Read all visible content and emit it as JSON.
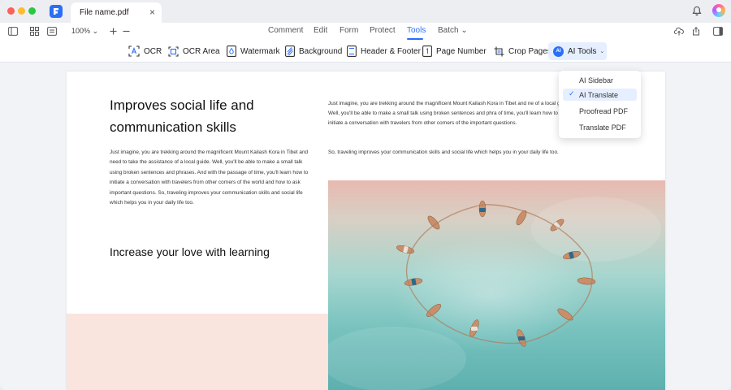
{
  "window": {
    "tab_title": "File name.pdf",
    "tab_close": "×"
  },
  "toolbar": {
    "zoom": "100% ⌄",
    "menus": [
      "Comment",
      "Edit",
      "Form",
      "Protect",
      "Tools",
      "Batch ⌄"
    ],
    "active_menu": "Tools"
  },
  "tools": {
    "ocr": "OCR",
    "ocr_area": "OCR Area",
    "watermark": "Watermark",
    "background": "Background",
    "header_footer": "Header & Footer",
    "page_number": "Page Number",
    "crop_pages": "Crop Pages",
    "ai_tools": "AI Tools",
    "ai_badge": "AI",
    "ai_caret": "⌄"
  },
  "ai_menu": {
    "items": [
      {
        "label": "AI Sidebar",
        "selected": false
      },
      {
        "label": "AI Translate",
        "selected": true
      },
      {
        "label": "Proofread PDF",
        "selected": false
      },
      {
        "label": "Translate PDF",
        "selected": false
      }
    ],
    "check": "✓"
  },
  "document": {
    "heading": "Improves social life and communication skills",
    "body_left": "Just imagine, you are trekking around the magnificent Mount Kailash Kora in Tibet and need to take the assistance of a local guide. Well, you'll be able to make a small talk using broken sentences and phrases. And with the passage of time, you'll learn how to initiate a conversation with travelers from other corners of the world and how to ask important questions. So, traveling improves your communication skills and social life which helps you in your daily life too.",
    "subheading": "Increase your love with learning",
    "body_right_1": "Just imagine, you are trekking around the magnificent Mount Kailash Kora in Tibet and ne of a local guide. Well, you'll be able to make a small talk using broken sentences and phra of time, you'll learn how to initiate a conversation with travelers from other corners of the important questions.",
    "body_right_2": "So, traveling improves your communication skills and social life which helps you in your daily life too."
  },
  "colors": {
    "accent": "#2b6ff6",
    "pink_block": "#f9e4de",
    "water": "#79c3bf"
  },
  "icons": [
    "app-logo-icon",
    "bell-icon",
    "sidebar-toggle-icon",
    "grid-view-icon",
    "layout-icon",
    "zoom-in-icon",
    "zoom-out-icon",
    "upload-icon",
    "share-icon",
    "panel-toggle-icon"
  ]
}
